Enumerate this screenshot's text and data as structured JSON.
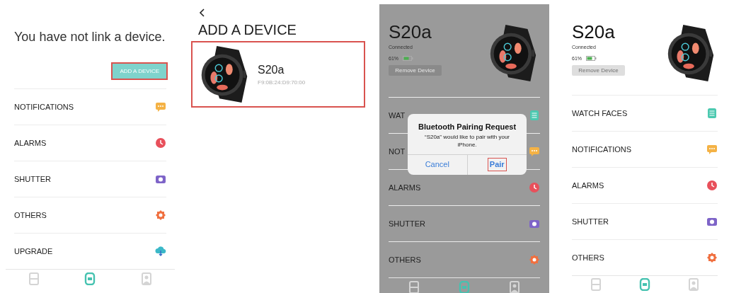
{
  "screens": [
    {
      "kind": "home_unlinked",
      "heading": "You have not link a device.",
      "add_button": {
        "label": "ADD A DEVICE",
        "highlighted": true
      },
      "menu": [
        {
          "label": "NOTIFICATIONS",
          "kind": "notifications",
          "color": "#f4b245"
        },
        {
          "label": "ALARMS",
          "kind": "alarms",
          "color": "#e8505b"
        },
        {
          "label": "SHUTTER",
          "kind": "shutter",
          "color": "#7e64c8"
        },
        {
          "label": "OTHERS",
          "kind": "others",
          "color": "#f07040"
        },
        {
          "label": "UPGRADE",
          "kind": "upgrade",
          "color": "#3bb8c8"
        }
      ],
      "tabs": [
        {
          "kind": "list",
          "selected": false
        },
        {
          "kind": "watch",
          "selected": true
        },
        {
          "kind": "profile",
          "selected": false
        }
      ]
    },
    {
      "kind": "add_device",
      "title": "ADD A DEVICE",
      "device": {
        "name": "S20a",
        "address": "F9:0B:24:D9:70:00",
        "highlighted": true
      }
    },
    {
      "kind": "home_linked",
      "device": {
        "name": "S20a",
        "status": "Connected",
        "battery": "61%"
      },
      "remove_button": "Remove Device",
      "menu": [
        {
          "label": "WAT",
          "kind": "watch_faces",
          "color": "#4cc9b0"
        },
        {
          "label": "NOT",
          "kind": "notifications",
          "color": "#f4b245"
        },
        {
          "label": "ALARMS",
          "kind": "alarms",
          "color": "#e8505b"
        },
        {
          "label": "SHUTTER",
          "kind": "shutter",
          "color": "#7e64c8"
        },
        {
          "label": "OTHERS",
          "kind": "others",
          "color": "#f07040"
        }
      ],
      "tabs": [
        {
          "kind": "list",
          "selected": false
        },
        {
          "kind": "watch",
          "selected": true
        },
        {
          "kind": "profile",
          "selected": false
        }
      ],
      "dialog": {
        "title": "Bluetooth Pairing Request",
        "message": "“S20a” would like to pair with your iPhone.",
        "buttons": [
          {
            "label": "Cancel",
            "highlighted": false
          },
          {
            "label": "Pair",
            "highlighted": true
          }
        ]
      }
    },
    {
      "kind": "home_linked",
      "device": {
        "name": "S20a",
        "status": "Connected",
        "battery": "61%"
      },
      "remove_button": "Remove Device",
      "menu": [
        {
          "label": "WATCH FACES",
          "kind": "watch_faces",
          "color": "#4cc9b0"
        },
        {
          "label": "NOTIFICATIONS",
          "kind": "notifications",
          "color": "#f4b245"
        },
        {
          "label": "ALARMS",
          "kind": "alarms",
          "color": "#e8505b"
        },
        {
          "label": "SHUTTER",
          "kind": "shutter",
          "color": "#7e64c8"
        },
        {
          "label": "OTHERS",
          "kind": "others",
          "color": "#f07040"
        }
      ],
      "tabs": [
        {
          "kind": "list",
          "selected": false
        },
        {
          "kind": "watch",
          "selected": true
        },
        {
          "kind": "profile",
          "selected": false
        }
      ]
    }
  ]
}
